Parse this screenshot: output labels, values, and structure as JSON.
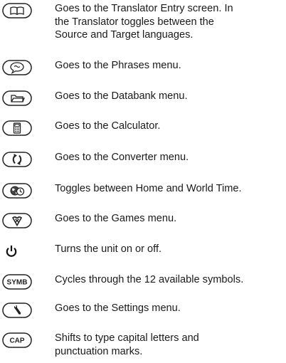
{
  "keys": [
    {
      "icon": "book-icon",
      "lines": [
        "Goes to the Translator Entry screen. In",
        "the Translator toggles between the",
        "Source  and Target languages."
      ]
    },
    {
      "icon": "speech-bubble-icon",
      "lines": [
        "Goes to the Phrases menu."
      ]
    },
    {
      "icon": "folder-icon",
      "lines": [
        "Goes to the Databank menu."
      ]
    },
    {
      "icon": "calculator-icon",
      "lines": [
        "Goes to the Calculator."
      ]
    },
    {
      "icon": "converter-arrows-icon",
      "lines": [
        "Goes to the Converter menu."
      ]
    },
    {
      "icon": "globe-clock-icon",
      "lines": [
        "Toggles between Home and World Time."
      ]
    },
    {
      "icon": "games-icon",
      "lines": [
        "Goes to the Games menu."
      ]
    },
    {
      "icon": "power-icon",
      "lines": [
        "Turns the unit on or off."
      ]
    },
    {
      "icon": "symb-key-icon",
      "label": "SYMB",
      "lines": [
        "Cycles through the 12 available symbols."
      ]
    },
    {
      "icon": "wrench-icon",
      "lines": [
        "Goes to the Settings menu."
      ]
    },
    {
      "icon": "cap-key-icon",
      "label": "CAP",
      "lines": [
        "Shifts to type capital letters and",
        "punctuation marks."
      ]
    }
  ]
}
